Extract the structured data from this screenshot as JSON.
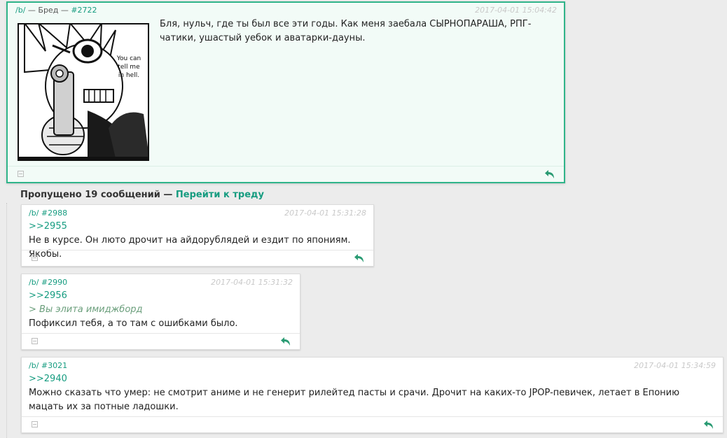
{
  "op": {
    "board": "/b/",
    "separator": "—",
    "board_name": "Бред",
    "num": "#2722",
    "date": "2017-04-01 15:04:42",
    "text": "Бля, нульч, где ты был все эти годы. Как меня заебала СЫРНОПАРАША, РПГ-чатики, ушастый уебок и аватарки-дауны.",
    "image_caption": [
      "You can",
      "tell me",
      "in hell."
    ]
  },
  "skipped": {
    "label": "Пропущено 19 сообщений",
    "separator": "—",
    "goto": "Перейти к треду"
  },
  "replies": [
    {
      "board": "/b/",
      "num": "#2988",
      "date": "2017-04-01 15:31:28",
      "reply_to": ">>2955",
      "quote": "",
      "text": "Не в курсе. Он люто дрочит на айдорублядей и ездит по япониям. Якобы."
    },
    {
      "board": "/b/",
      "num": "#2990",
      "date": "2017-04-01 15:31:32",
      "reply_to": ">>2956",
      "quote": "> Вы элита имиджборд",
      "text": "Пофиксил тебя, а то там с ошибками было."
    },
    {
      "board": "/b/",
      "num": "#3021",
      "date": "2017-04-01 15:34:59",
      "reply_to": ">>2940",
      "quote": "",
      "text": "Можно сказать что умер: не смотрит аниме и не генерит рилейтед пасты и срачи. Дрочит на каких-то JPOP-певичек, летает в Епонию мацать их за потные ладошки."
    }
  ],
  "colors": {
    "accent": "#169c80",
    "op_border": "#30b48a",
    "op_background": "#f2fbf7",
    "date": "#c9c9c9",
    "greentext": "#6a9e7b"
  },
  "icons": {
    "hide": "minus-square-icon",
    "reply": "reply-arrow-icon"
  }
}
